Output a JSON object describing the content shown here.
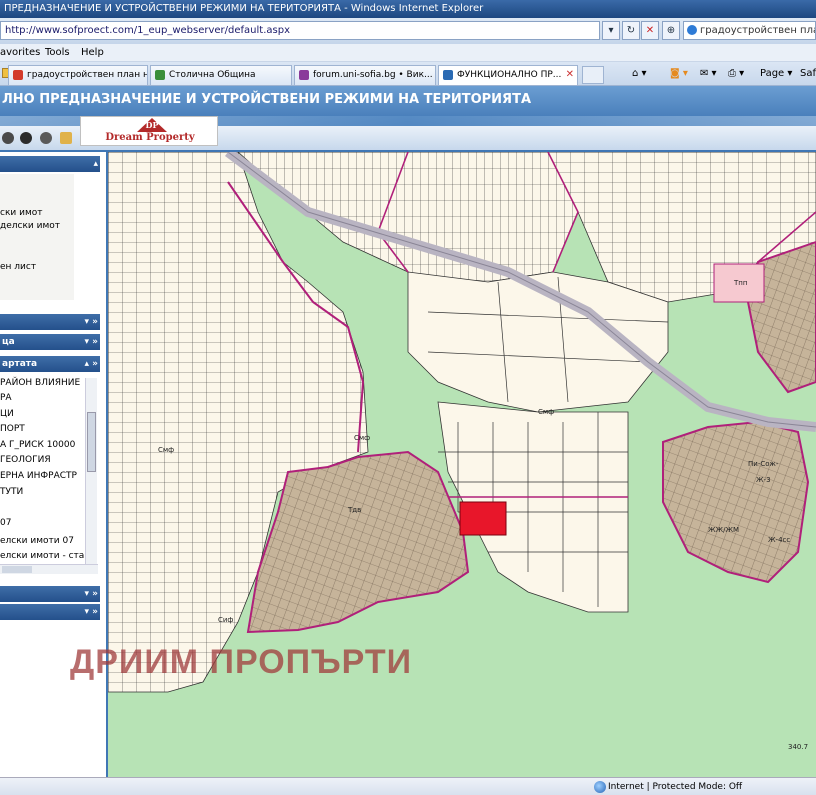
{
  "window": {
    "title": "ПРЕДНАЗНАЧЕНИЕ И УСТРОЙСТВЕНИ РЕЖИМИ НА ТЕРИТОРИЯТА - Windows Internet Explorer",
    "address": "http://www.sofproect.com/1_eup_webserver/default.aspx",
    "search_value": "градоустройствен план на..."
  },
  "menu": {
    "items": [
      "avorites",
      "Tools",
      "Help"
    ]
  },
  "tabs": [
    {
      "label": "градоустройствен план н...",
      "icon_color": "#d33b2b"
    },
    {
      "label": "Столична Община",
      "icon_color": "#3a8f3a"
    },
    {
      "label": "forum.uni-sofia.bg • Вик...",
      "icon_color": "#8a3b9a"
    },
    {
      "label": "ФУНКЦИОНАЛНО ПР...",
      "icon_color": "#2a6ab3"
    }
  ],
  "toolbar": {
    "page_label": "Page ▾",
    "safety_label": "Safe",
    "home_icon": "home-icon",
    "print_icon": "print-icon"
  },
  "app": {
    "title": "ЛНО ПРЕДНАЗНАЧЕНИЕ И УСТРОЙСТВЕНИ РЕЖИМИ НА ТЕРИТОРИЯТА",
    "logo_mark": "DP",
    "logo_name": "Dream Property"
  },
  "sidebar": {
    "search_items": [
      "ски имот",
      "делски имот",
      "ен лист"
    ],
    "panel2_label": "ца",
    "layers_label": "артата",
    "layers": [
      "РАЙОН ВЛИЯНИЕ",
      "РА",
      "ЦИ",
      "ПОРТ",
      "А Г_РИСК 10000",
      "ГЕОЛОГИЯ",
      "ЕРНА ИНФРАСТР",
      "ТУТИ",
      "",
      "07",
      "елски имоти 07",
      "елски имоти - стар"
    ]
  },
  "map": {
    "labels": [
      "Тпп",
      "Смф",
      "Смф",
      "Смф",
      "Пи-Сож-",
      "Ж-3",
      "ЖЖ/ЖМ",
      "Тдв",
      "Ж-4сс",
      "340.7",
      "Сиф"
    ],
    "colors": {
      "forest": "#b7e3b5",
      "parcel_fill": "#fcf7ea",
      "built_zone": "#c6b49a",
      "zone_border": "#b0207a",
      "road": "#b9b4c2",
      "selected_parcel": "#e8162a"
    }
  },
  "watermark": "ДРИИМ ПРОПЪРТИ",
  "status": {
    "zone": "Internet | Protected Mode: Off",
    "zoom": ""
  }
}
